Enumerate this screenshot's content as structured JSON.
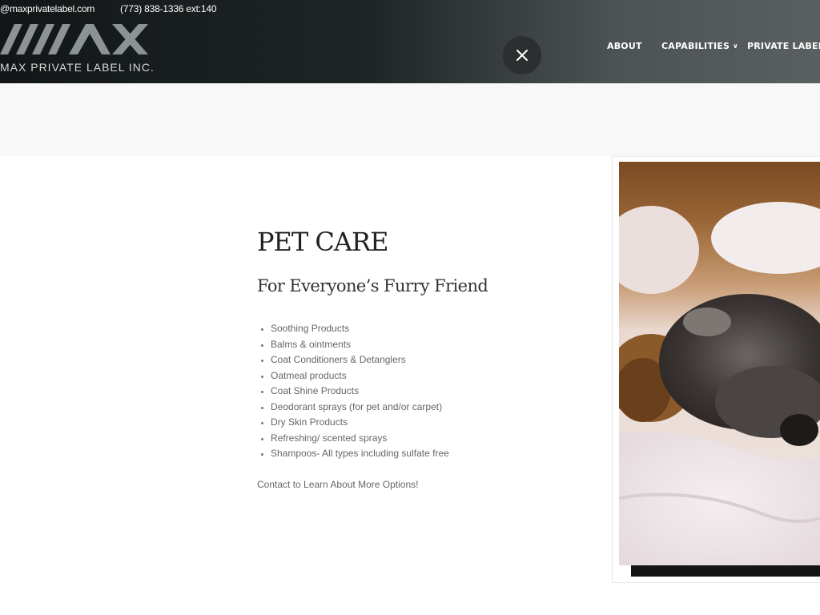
{
  "topbar": {
    "email": "@maxprivatelabel.com",
    "phone": "(773) 838-1336 ext:140"
  },
  "logo": {
    "mark": "MAX",
    "company": "MAX PRIVATE LABEL INC."
  },
  "close_icon": "close-icon",
  "nav": {
    "about": "ABOUT",
    "capabilities": "CAPABILITIES",
    "capabilities_icon": "chevron-down-icon",
    "private_label": "PRIVATE LABEL"
  },
  "content": {
    "title": "PET CARE",
    "subtitle": "For Everyone’s Furry Friend",
    "features": [
      "Soothing Products",
      "Balms & ointments",
      "Coat Conditioners & Detanglers",
      "Oatmeal products",
      "Coat Shine Products",
      "Deodorant sprays (for pet and/or carpet)",
      "Dry Skin Products",
      "Refreshing/ scented sprays",
      "Shampoos- All types including sulfate free"
    ],
    "contact": "Contact to Learn About More Options!"
  },
  "colors": {
    "header_dark": "#121617",
    "header_light": "#5a6061",
    "close_button": "#2b2f30",
    "band": "#f8f8f8"
  }
}
